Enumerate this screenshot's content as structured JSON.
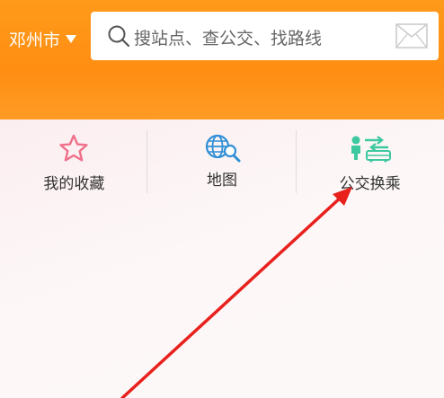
{
  "header": {
    "city": "邓州市",
    "search_placeholder": "搜站点、查公交、找路线"
  },
  "nav": {
    "items": [
      {
        "label": "我的收藏",
        "icon": "star-icon"
      },
      {
        "label": "地图",
        "icon": "globe-search-icon"
      },
      {
        "label": "公交换乘",
        "icon": "bus-transfer-icon"
      }
    ]
  },
  "colors": {
    "header_orange": "#ff9a1a",
    "star_pink": "#f0708a",
    "globe_blue": "#2f8fd6",
    "transfer_green": "#3dc9a0",
    "annotation_arrow": "#e8211d"
  }
}
